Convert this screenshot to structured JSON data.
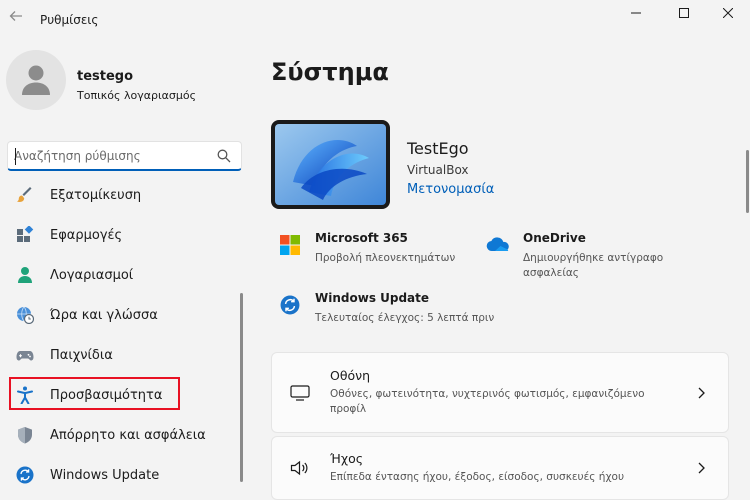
{
  "window": {
    "title": "Ρυθμίσεις"
  },
  "profile": {
    "name": "testego",
    "account_type": "Τοπικός λογαριασμός"
  },
  "search": {
    "placeholder": "Αναζήτηση ρύθμισης"
  },
  "sidebar": {
    "items": [
      {
        "label": "Εξατομίκευση",
        "icon": "brush-icon"
      },
      {
        "label": "Εφαρμογές",
        "icon": "apps-icon"
      },
      {
        "label": "Λογαριασμοί",
        "icon": "person-icon"
      },
      {
        "label": "Ώρα και γλώσσα",
        "icon": "clock-globe-icon"
      },
      {
        "label": "Παιχνίδια",
        "icon": "gamepad-icon"
      },
      {
        "label": "Προσβασιμότητα",
        "icon": "accessibility-icon"
      },
      {
        "label": "Απόρρητο και ασφάλεια",
        "icon": "shield-icon"
      },
      {
        "label": "Windows Update",
        "icon": "update-icon"
      }
    ]
  },
  "main": {
    "title": "Σύστημα",
    "device": {
      "name": "TestEgo",
      "model": "VirtualBox",
      "rename_label": "Μετονομασία"
    },
    "tiles": [
      {
        "title": "Microsoft 365",
        "subtitle": "Προβολή πλεονεκτημάτων",
        "icon": "microsoft-logo-icon"
      },
      {
        "title": "OneDrive",
        "subtitle": "Δημιουργήθηκε αντίγραφο ασφαλείας",
        "icon": "onedrive-cloud-icon"
      },
      {
        "title": "Windows Update",
        "subtitle": "Τελευταίος έλεγχος: 5 λεπτά πριν",
        "icon": "update-icon"
      }
    ],
    "cards": [
      {
        "title": "Οθόνη",
        "subtitle": "Οθόνες, φωτεινότητα, νυχτερινός φωτισμός, εμφανιζόμενο προφίλ",
        "icon": "monitor-icon"
      },
      {
        "title": "Ήχος",
        "subtitle": "Επίπεδα έντασης ήχου, έξοδος, είσοδος, συσκευές ήχου",
        "icon": "speaker-icon"
      }
    ]
  },
  "colors": {
    "accent": "#005fb8",
    "highlight": "#e81123",
    "background": "#f3f3f3"
  }
}
